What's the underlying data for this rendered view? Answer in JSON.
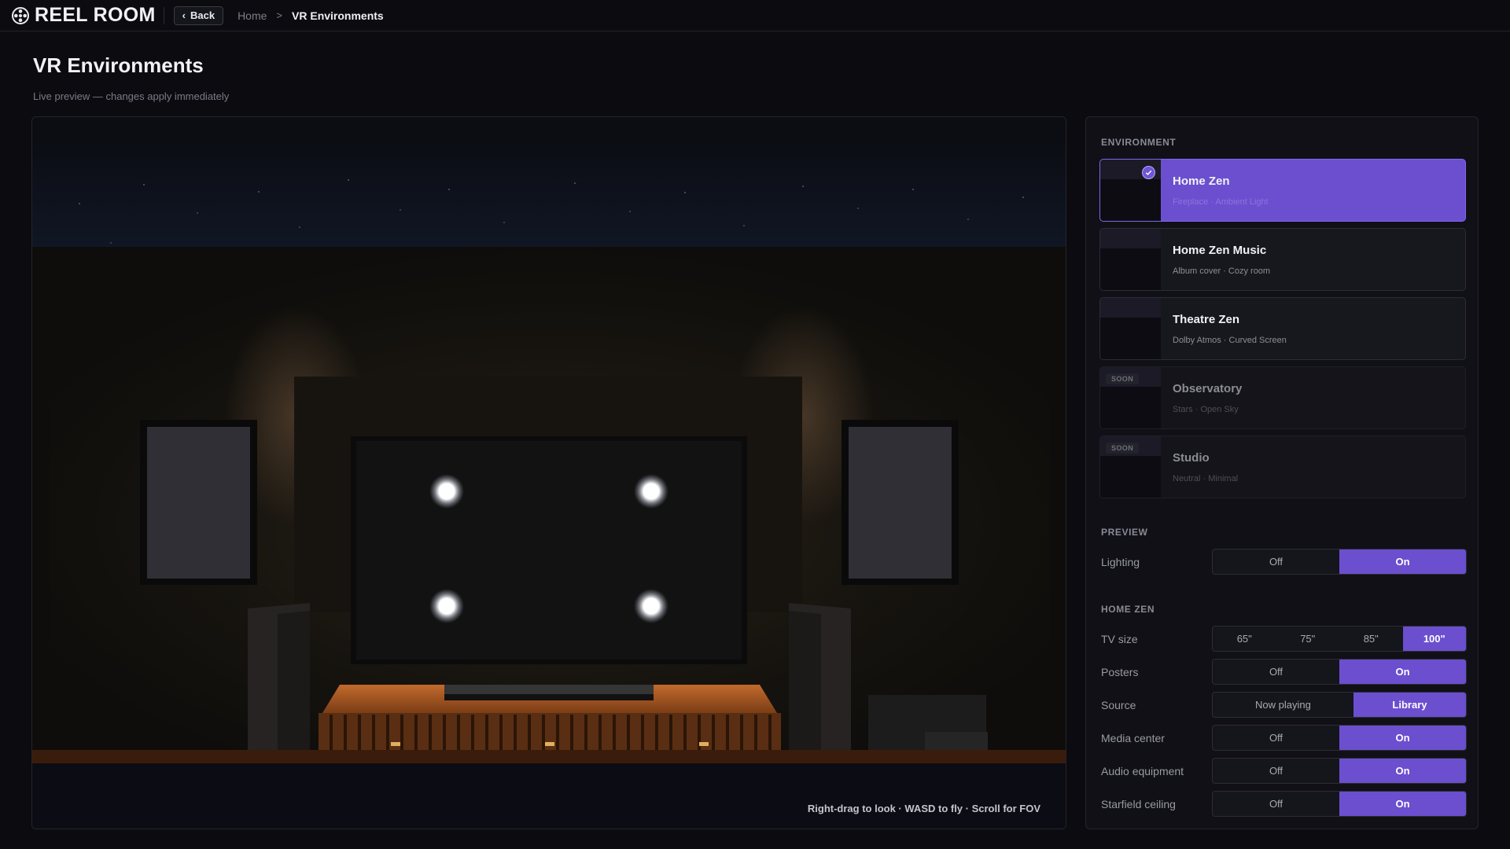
{
  "app": {
    "name": "REEL ROOM",
    "logo_icon": "film-reel-icon"
  },
  "nav": {
    "back_label": "Back",
    "breadcrumb": [
      "Home",
      "VR Environments"
    ],
    "separator": ">"
  },
  "page": {
    "title": "VR Environments",
    "subtitle": "Live preview — changes apply immediately"
  },
  "viewport": {
    "hint": "Right-drag to look · WASD to fly · Scroll for FOV"
  },
  "environment": {
    "label": "ENVIRONMENT",
    "items": [
      {
        "name": "Home Zen",
        "desc": "Fireplace · Ambient Light",
        "state": "selected",
        "badge": ""
      },
      {
        "name": "Home Zen Music",
        "desc": "Album cover · Cozy room",
        "state": "normal",
        "badge": ""
      },
      {
        "name": "Theatre Zen",
        "desc": "Dolby Atmos · Curved Screen",
        "state": "normal",
        "badge": ""
      },
      {
        "name": "Observatory",
        "desc": "Stars · Open Sky",
        "state": "disabled",
        "badge": "SOON"
      },
      {
        "name": "Studio",
        "desc": "Neutral · Minimal",
        "state": "disabled",
        "badge": "SOON"
      }
    ]
  },
  "preview": {
    "label": "PREVIEW",
    "rows": [
      {
        "label": "Lighting",
        "options": [
          "Off",
          "On"
        ],
        "selected": "On"
      }
    ]
  },
  "home_zen": {
    "label": "HOME ZEN",
    "rows": [
      {
        "label": "TV size",
        "options": [
          "65\"",
          "75\"",
          "85\"",
          "100\""
        ],
        "selected": "100\""
      },
      {
        "label": "Posters",
        "options": [
          "Off",
          "On"
        ],
        "selected": "On"
      },
      {
        "label": "Source",
        "options": [
          "Now playing",
          "Library"
        ],
        "selected": "Library"
      },
      {
        "label": "Media center",
        "options": [
          "Off",
          "On"
        ],
        "selected": "On"
      },
      {
        "label": "Audio equipment",
        "options": [
          "Off",
          "On"
        ],
        "selected": "On"
      },
      {
        "label": "Starfield ceiling",
        "options": [
          "Off",
          "On"
        ],
        "selected": "On"
      }
    ]
  },
  "colors": {
    "accent": "#6b4fcf",
    "background": "#0b0b10",
    "panel": "#101016"
  }
}
